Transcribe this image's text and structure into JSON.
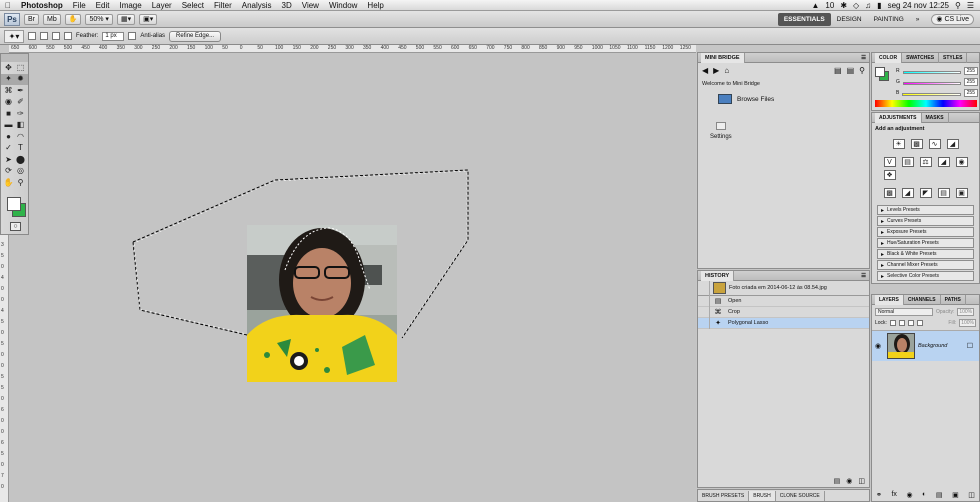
{
  "menubar": {
    "app": "Photoshop",
    "items": [
      "File",
      "Edit",
      "Image",
      "Layer",
      "Select",
      "Filter",
      "Analysis",
      "3D",
      "View",
      "Window",
      "Help"
    ],
    "status": {
      "adobe_count": "10",
      "datetime": "seg 24 nov  12:25"
    }
  },
  "appbar": {
    "logo": "Ps",
    "zoom": "50%",
    "workspaces": [
      "ESSENTIALS",
      "DESIGN",
      "PAINTING"
    ],
    "more": "»",
    "cslive": "CS Live"
  },
  "options": {
    "feather_label": "Feather:",
    "feather_value": "1 px",
    "antialias_label": "Anti-alias",
    "refine_edge": "Refine Edge..."
  },
  "ruler": {
    "top": [
      "650",
      "600",
      "550",
      "500",
      "450",
      "400",
      "350",
      "300",
      "250",
      "200",
      "150",
      "100",
      "50",
      "0",
      "50",
      "100",
      "150",
      "200",
      "250",
      "300",
      "350",
      "400",
      "450",
      "500",
      "550",
      "600",
      "650",
      "700",
      "750",
      "800",
      "850",
      "900",
      "950",
      "1000",
      "1050",
      "1100",
      "1150",
      "1200",
      "1250"
    ],
    "left": [
      "0",
      "5",
      "1",
      "0",
      "0",
      "1",
      "5",
      "0",
      "2",
      "0",
      "0",
      "2",
      "5",
      "0",
      "3",
      "0",
      "0",
      "3",
      "5",
      "0",
      "4",
      "0",
      "0",
      "4",
      "5",
      "0",
      "5",
      "0",
      "0",
      "5",
      "5",
      "0",
      "6",
      "0",
      "0",
      "6",
      "5",
      "0",
      "7",
      "0"
    ]
  },
  "minibridge": {
    "title": "MINI BRIDGE",
    "welcome": "Welcome to Mini Bridge",
    "browse": "Browse Files",
    "settings": "Settings"
  },
  "history": {
    "title": "HISTORY",
    "snapshot": "Foto criada em 2014-06-12 às 08.54.jpg",
    "items": [
      "Open",
      "Crop",
      "Polygonal Lasso"
    ]
  },
  "bottomtabs": [
    "BRUSH PRESETS",
    "BRUSH",
    "CLONE SOURCE"
  ],
  "color": {
    "tabs": [
      "COLOR",
      "SWATCHES",
      "STYLES"
    ],
    "r_label": "R",
    "g_label": "G",
    "b_label": "B",
    "r": "255",
    "g": "255",
    "b": "255"
  },
  "adjust": {
    "tabs": [
      "ADJUSTMENTS",
      "MASKS"
    ],
    "heading": "Add an adjustment",
    "presets": [
      "Levels Presets",
      "Curves Presets",
      "Exposure Presets",
      "Hue/Saturation Presets",
      "Black & White Presets",
      "Channel Mixer Presets",
      "Selective Color Presets"
    ]
  },
  "layers": {
    "tabs": [
      "LAYERS",
      "CHANNELS",
      "PATHS"
    ],
    "blend": "Normal",
    "opacity_label": "Opacity:",
    "opacity": "100%",
    "lock_label": "Lock:",
    "fill_label": "Fill:",
    "fill": "100%",
    "layer_name": "Background"
  },
  "colors": {
    "accent": "#b9d3f1",
    "bg_swatch": "#2fb34a",
    "workspace_active": "#555555"
  }
}
